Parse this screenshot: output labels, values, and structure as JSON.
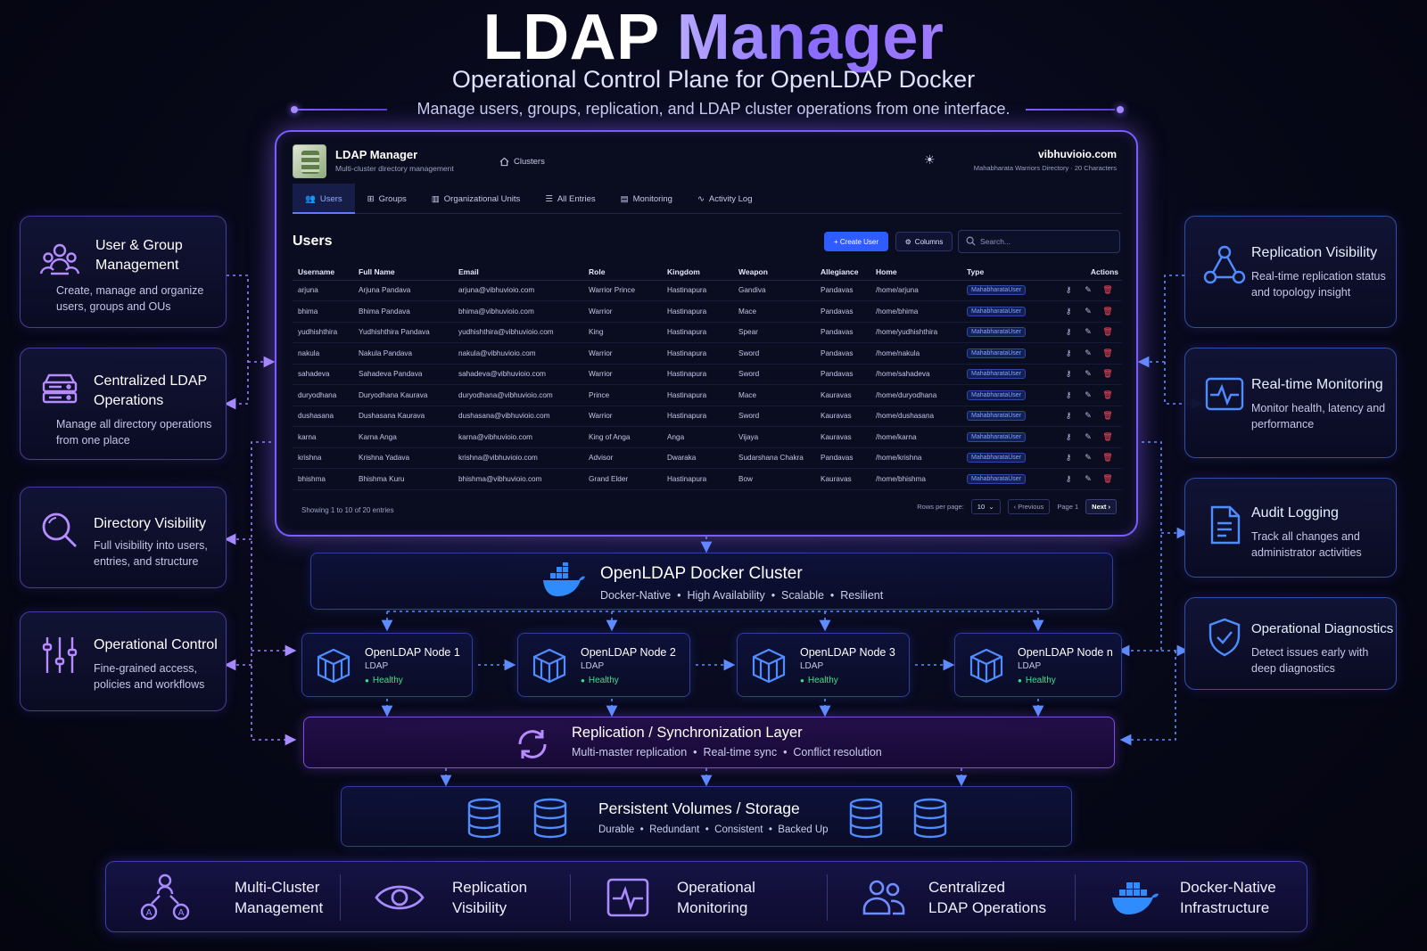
{
  "header": {
    "title_part1": "LDAP ",
    "title_part2": "Manager",
    "subtitle": "Operational Control Plane for OpenLDAP Docker",
    "tagline": "Manage users, groups, replication, and LDAP cluster operations from one interface."
  },
  "left_cards": [
    {
      "title": "User & Group Management",
      "desc": "Create, manage and organize users, groups and OUs",
      "icon": "users-icon"
    },
    {
      "title": "Centralized LDAP Operations",
      "desc": "Manage all directory operations from one place",
      "icon": "server-icon"
    },
    {
      "title": "Directory Visibility",
      "desc": "Full visibility into users, entries, and structure",
      "icon": "search-icon"
    },
    {
      "title": "Operational Control",
      "desc": "Fine-grained access, policies and workflows",
      "icon": "sliders-icon"
    }
  ],
  "right_cards": [
    {
      "title": "Replication Visibility",
      "desc": "Real-time replication status and topology insight",
      "icon": "topology-icon"
    },
    {
      "title": "Real-time Monitoring",
      "desc": "Monitor health, latency and performance",
      "icon": "pulse-icon"
    },
    {
      "title": "Audit Logging",
      "desc": "Track all changes and administrator activities",
      "icon": "document-icon"
    },
    {
      "title": "Operational Diagnostics",
      "desc": "Detect issues early with deep diagnostics",
      "icon": "shield-check-icon"
    }
  ],
  "app": {
    "name": "LDAP Manager",
    "sub": "Multi-cluster directory management",
    "clusters_label": "Clusters",
    "domain": "vibhuvioio.com",
    "domain_sub": "Mahabharata Warriors Directory · 20 Characters",
    "tabs": [
      "Users",
      "Groups",
      "Organizational Units",
      "All Entries",
      "Monitoring",
      "Activity Log"
    ],
    "section_title": "Users",
    "create_label": "Create User",
    "columns_label": "Columns",
    "search_placeholder": "Search...",
    "columns": [
      "Username",
      "Full Name",
      "Email",
      "Role",
      "Kingdom",
      "Weapon",
      "Allegiance",
      "Home",
      "Type",
      "Actions"
    ],
    "rows": [
      [
        "arjuna",
        "Arjuna Pandava",
        "arjuna@vibhuvioio.com",
        "Warrior Prince",
        "Hastinapura",
        "Gandiva",
        "Pandavas",
        "/home/arjuna",
        "MahabharataUser"
      ],
      [
        "bhima",
        "Bhima Pandava",
        "bhima@vibhuvioio.com",
        "Warrior",
        "Hastinapura",
        "Mace",
        "Pandavas",
        "/home/bhima",
        "MahabharataUser"
      ],
      [
        "yudhishthira",
        "Yudhishthira Pandava",
        "yudhishthira@vibhuvioio.com",
        "King",
        "Hastinapura",
        "Spear",
        "Pandavas",
        "/home/yudhishthira",
        "MahabharataUser"
      ],
      [
        "nakula",
        "Nakula Pandava",
        "nakula@vibhuvioio.com",
        "Warrior",
        "Hastinapura",
        "Sword",
        "Pandavas",
        "/home/nakula",
        "MahabharataUser"
      ],
      [
        "sahadeva",
        "Sahadeva Pandava",
        "sahadeva@vibhuvioio.com",
        "Warrior",
        "Hastinapura",
        "Sword",
        "Pandavas",
        "/home/sahadeva",
        "MahabharataUser"
      ],
      [
        "duryodhana",
        "Duryodhana Kaurava",
        "duryodhana@vibhuvioio.com",
        "Prince",
        "Hastinapura",
        "Mace",
        "Kauravas",
        "/home/duryodhana",
        "MahabharataUser"
      ],
      [
        "dushasana",
        "Dushasana Kaurava",
        "dushasana@vibhuvioio.com",
        "Warrior",
        "Hastinapura",
        "Sword",
        "Kauravas",
        "/home/dushasana",
        "MahabharataUser"
      ],
      [
        "karna",
        "Karna Anga",
        "karna@vibhuvioio.com",
        "King of Anga",
        "Anga",
        "Vijaya",
        "Kauravas",
        "/home/karna",
        "MahabharataUser"
      ],
      [
        "krishna",
        "Krishna Yadava",
        "krishna@vibhuvioio.com",
        "Advisor",
        "Dwaraka",
        "Sudarshana Chakra",
        "Pandavas",
        "/home/krishna",
        "MahabharataUser"
      ],
      [
        "bhishma",
        "Bhishma Kuru",
        "bhishma@vibhuvioio.com",
        "Grand Elder",
        "Hastinapura",
        "Bow",
        "Kauravas",
        "/home/bhishma",
        "MahabharataUser"
      ]
    ],
    "showing": "Showing 1 to 10 of 20 entries",
    "rows_per_page_label": "Rows per page:",
    "rows_per_page": "10",
    "prev_label": "‹ Previous",
    "page_label": "Page 1",
    "next_label": "Next ›"
  },
  "cluster": {
    "title": "OpenLDAP Docker Cluster",
    "sub": "Docker-Native  •  High Availability  •  Scalable  •  Resilient"
  },
  "nodes": [
    {
      "title": "OpenLDAP Node 1",
      "sub": "LDAP",
      "status": "Healthy"
    },
    {
      "title": "OpenLDAP Node 2",
      "sub": "LDAP",
      "status": "Healthy"
    },
    {
      "title": "OpenLDAP Node 3",
      "sub": "LDAP",
      "status": "Healthy"
    },
    {
      "title": "OpenLDAP Node n",
      "sub": "LDAP",
      "status": "Healthy"
    }
  ],
  "replication": {
    "title": "Replication / Synchronization Layer",
    "sub": "Multi-master replication  •  Real-time sync  •  Conflict resolution"
  },
  "storage": {
    "title": "Persistent Volumes / Storage",
    "sub": "Durable  •  Redundant  •  Consistent  •  Backed Up"
  },
  "bottom_items": [
    {
      "line1": "Multi-Cluster",
      "line2": "Management",
      "icon": "hierarchy-icon"
    },
    {
      "line1": "Replication",
      "line2": "Visibility",
      "icon": "eye-icon"
    },
    {
      "line1": "Operational",
      "line2": "Monitoring",
      "icon": "monitor-pulse-icon"
    },
    {
      "line1": "Centralized",
      "line2": "LDAP Operations",
      "icon": "users-icon"
    },
    {
      "line1": "Docker-Native",
      "line2": "Infrastructure",
      "icon": "docker-icon"
    }
  ],
  "colors": {
    "accent_purple": "#7b5cff",
    "accent_blue": "#2f5cff",
    "healthy_green": "#3ee08a",
    "delete_red": "#ff4a5e"
  }
}
